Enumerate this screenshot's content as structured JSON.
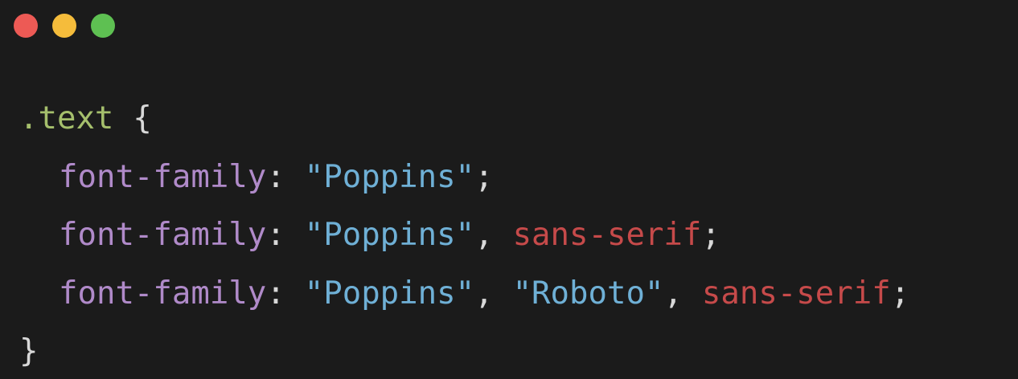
{
  "window": {
    "controls": [
      {
        "name": "close",
        "color": "#ed5a55"
      },
      {
        "name": "minimize",
        "color": "#f5bc3b"
      },
      {
        "name": "maximize",
        "color": "#5ec052"
      }
    ]
  },
  "colors": {
    "background": "#1b1b1b",
    "selector": "#a5bf6c",
    "brace": "#d8d8d8",
    "property": "#b08ac9",
    "punctuation": "#d8d8d8",
    "string": "#6fb0d6",
    "keyword": "#c64a4a"
  },
  "code": {
    "selector": ".text",
    "open_brace": "{",
    "close_brace": "}",
    "property": "font-family",
    "colon": ":",
    "comma": ",",
    "semicolon": ";",
    "string_poppins": "\"Poppins\"",
    "string_roboto": "\"Roboto\"",
    "generic_family": "sans-serif"
  }
}
